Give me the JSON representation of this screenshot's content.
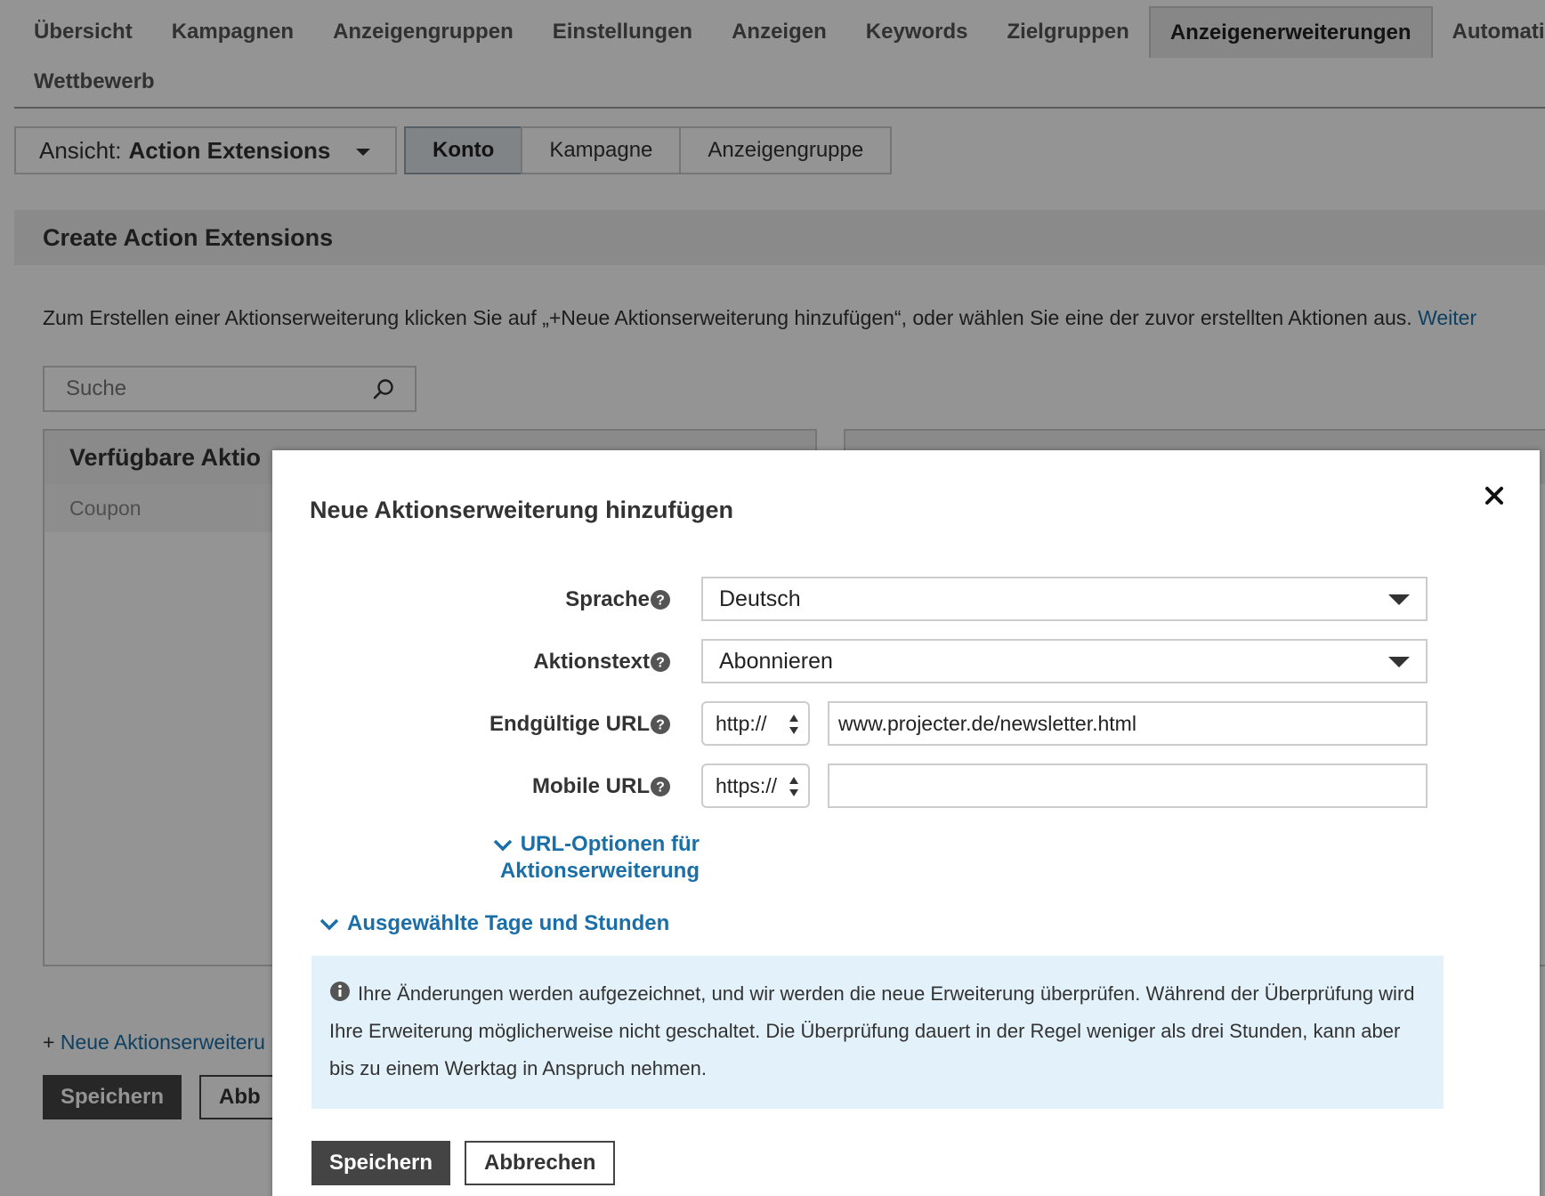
{
  "nav": {
    "tabs": [
      "Übersicht",
      "Kampagnen",
      "Anzeigengruppen",
      "Einstellungen",
      "Anzeigen",
      "Keywords",
      "Zielgruppen",
      "Anzeigenerweiterungen",
      "Automatis"
    ],
    "active_tab": "Anzeigenerweiterungen",
    "row2_tab": "Wettbewerb"
  },
  "view": {
    "prefix": "Ansicht:",
    "value": "Action Extensions",
    "scope_buttons": [
      "Konto",
      "Kampagne",
      "Anzeigengruppe"
    ],
    "active_scope": "Konto"
  },
  "card": {
    "title": "Create Action Extensions",
    "intro": "Zum Erstellen einer Aktionserweiterung klicken Sie auf „+Neue Aktionserweiterung hinzufügen“, oder wählen Sie eine der zuvor erstellten Aktionen aus.",
    "intro_link": "Weiter",
    "search_placeholder": "Suche",
    "left_panel_title": "Verfügbare Aktio",
    "left_panel_row": "Coupon",
    "add_prefix": "+",
    "add_link": "Neue Aktionserweiteru",
    "save_label": "Speichern",
    "cancel_label": "Abb"
  },
  "modal": {
    "title": "Neue Aktionserweiterung hinzufügen",
    "fields": {
      "language_label": "Sprache",
      "language_value": "Deutsch",
      "action_label": "Aktionstext",
      "action_value": "Abonnieren",
      "final_url_label": "Endgültige URL",
      "final_url_protocol": "http://",
      "final_url_value": "www.projecter.de/newsletter.html",
      "mobile_url_label": "Mobile URL",
      "mobile_url_protocol": "https://",
      "mobile_url_value": ""
    },
    "url_options_line1": "URL-Optionen für",
    "url_options_line2": "Aktionserweiterung",
    "days_toggle": "Ausgewählte Tage und Stunden",
    "info_text": "Ihre Änderungen werden aufgezeichnet, und wir werden die neue Erweiterung überprüfen. Während der Überprüfung wird Ihre Erweiterung möglicherweise nicht geschaltet. Die Überprüfung dauert in der Regel weniger als drei Stunden, kann aber bis zu einem Werktag in Anspruch nehmen.",
    "save_label": "Speichern",
    "cancel_label": "Abbrechen"
  },
  "colors": {
    "link": "#1a6fa8",
    "primary_button": "#444444",
    "info_background": "#e3f2fa",
    "overlay": "rgba(0,0,0,0.42)"
  },
  "icons": [
    "search-icon",
    "caret-down-icon",
    "help-icon",
    "close-icon",
    "chevron-down-icon",
    "info-icon",
    "updown-icon"
  ]
}
